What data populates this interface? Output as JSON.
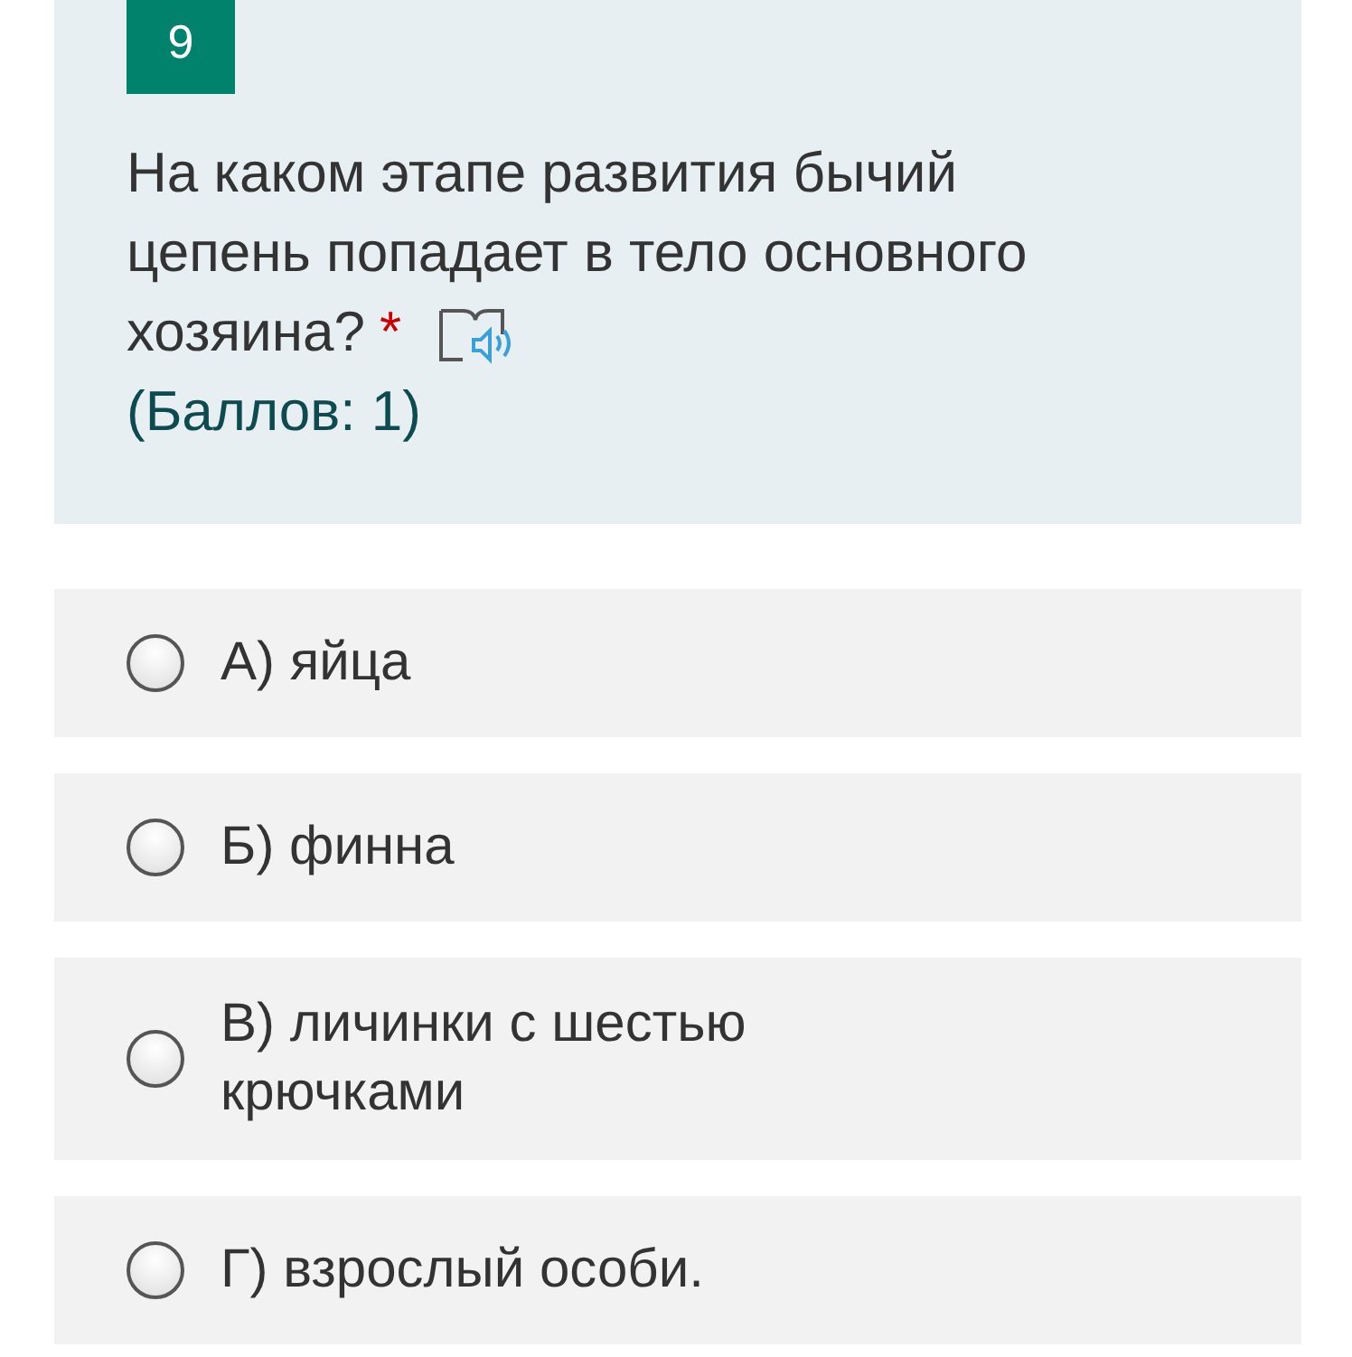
{
  "question": {
    "number": "9",
    "text_lines": [
      "На каком этапе развития бычий",
      "цепень попадает в тело основного",
      "хозяина?"
    ],
    "required": true,
    "required_mark": "*",
    "points": "(Баллов: 1)"
  },
  "options": [
    {
      "label": "А) яйца",
      "selected": false
    },
    {
      "label": "Б) финна",
      "selected": false
    },
    {
      "label": "В) личинки с шестью крючками",
      "selected": false
    },
    {
      "label": "Г) взрослый особи.",
      "selected": false
    }
  ]
}
